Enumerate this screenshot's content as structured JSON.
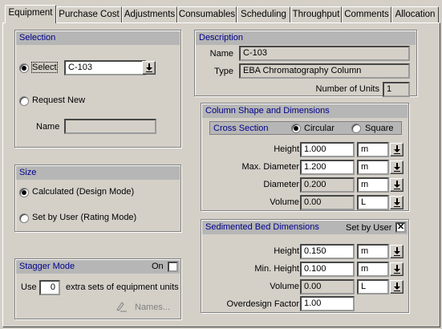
{
  "tabs": [
    "Equipment",
    "Purchase Cost",
    "Adjustments",
    "Consumables",
    "Scheduling",
    "Throughput",
    "Comments",
    "Allocation"
  ],
  "selection": {
    "header": "Selection",
    "select_label": "Select",
    "select_value": "C-103",
    "request_label": "Request New",
    "name_label": "Name",
    "name_value": ""
  },
  "size": {
    "header": "Size",
    "calculated_label": "Calculated (Design Mode)",
    "set_by_user_label": "Set by User (Rating Mode)"
  },
  "stagger": {
    "header": "Stagger Mode",
    "on_label": "On",
    "use_label": "Use",
    "count": "0",
    "extra_label": "extra sets of equipment units",
    "names_label": "Names..."
  },
  "description": {
    "header": "Description",
    "name_label": "Name",
    "name_value": "C-103",
    "type_label": "Type",
    "type_value": "EBA Chromatography Column",
    "units_label": "Number of Units",
    "units_value": "1"
  },
  "column_shape": {
    "header": "Column Shape and Dimensions",
    "cross_section_label": "Cross Section",
    "circular_label": "Circular",
    "square_label": "Square",
    "rows": [
      {
        "label": "Height",
        "value": "1.000",
        "unit": "m"
      },
      {
        "label": "Max. Diameter",
        "value": "1.200",
        "unit": "m"
      },
      {
        "label": "Diameter",
        "value": "0.200",
        "unit": "m"
      },
      {
        "label": "Volume",
        "value": "0.00",
        "unit": "L"
      }
    ]
  },
  "sedimented": {
    "header": "Sedimented Bed Dimensions",
    "set_by_user_label": "Set by User",
    "set_by_user_mark": "✕",
    "rows": [
      {
        "label": "Height",
        "value": "0.150",
        "unit": "m"
      },
      {
        "label": "Min. Height",
        "value": "0.100",
        "unit": "m"
      },
      {
        "label": "Volume",
        "value": "0.00",
        "unit": "L"
      }
    ],
    "overdesign_label": "Overdesign Factor",
    "overdesign_value": "1.00"
  }
}
